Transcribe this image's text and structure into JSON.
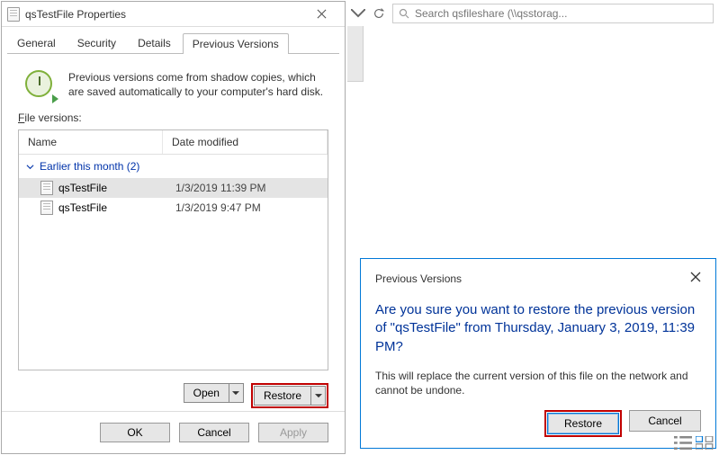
{
  "properties": {
    "title": "qsTestFile Properties",
    "tabs": {
      "general": "General",
      "security": "Security",
      "details": "Details",
      "previous": "Previous Versions"
    },
    "info": "Previous versions come from shadow copies, which are saved automatically to your computer's hard disk.",
    "file_versions_label": "File versions:",
    "columns": {
      "name": "Name",
      "date": "Date modified"
    },
    "group_label": "Earlier this month (2)",
    "rows": [
      {
        "name": "qsTestFile",
        "date": "1/3/2019 11:39 PM",
        "selected": true
      },
      {
        "name": "qsTestFile",
        "date": "1/3/2019 9:47 PM",
        "selected": false
      }
    ],
    "open_label": "Open",
    "restore_label": "Restore",
    "ok": "OK",
    "cancel": "Cancel",
    "apply": "Apply"
  },
  "search": {
    "placeholder": "Search qsfileshare (\\\\qsstorag..."
  },
  "confirm": {
    "title": "Previous Versions",
    "question": "Are you sure you want to restore the previous version of \"qsTestFile\" from Thursday, January 3, 2019, 11:39 PM?",
    "warning": "This will replace the current version of this file on the network and cannot be undone.",
    "restore": "Restore",
    "cancel": "Cancel"
  }
}
